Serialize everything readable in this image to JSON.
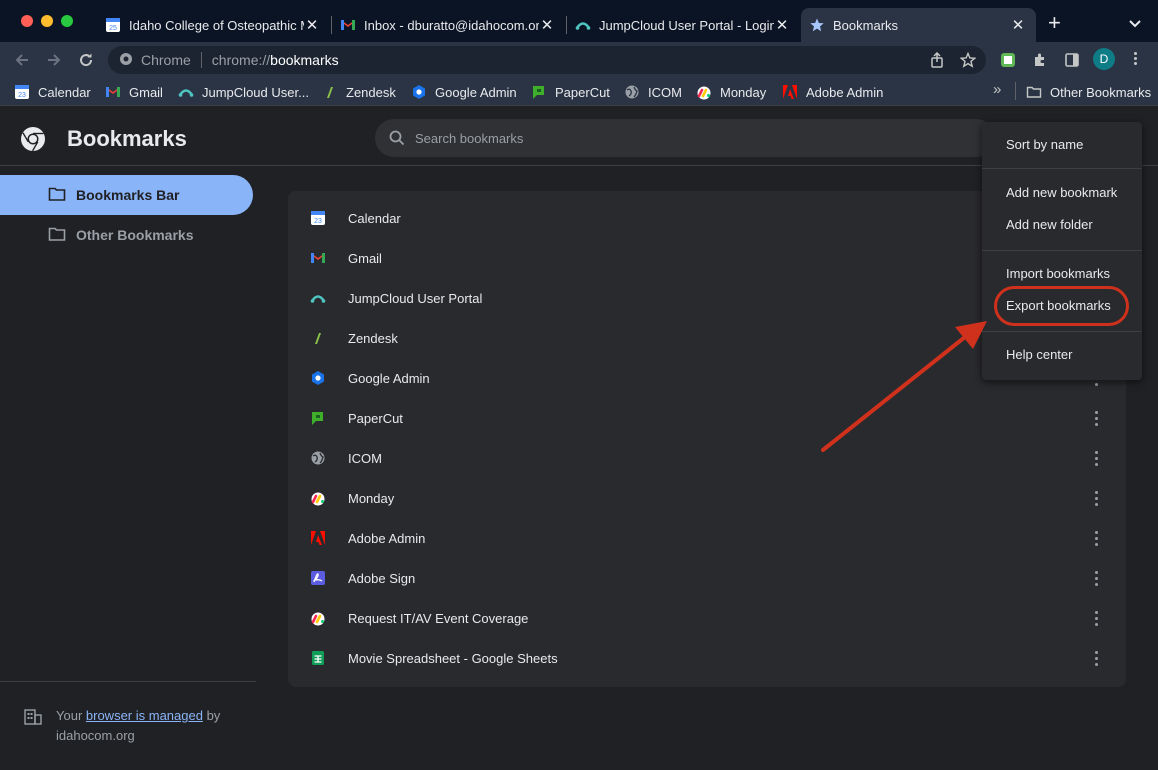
{
  "colors": {
    "accent": "#8ab4f8",
    "annotation_red": "#d0311c",
    "background": "#202124",
    "tabstrip": "#0b1424",
    "card": "#292a2d"
  },
  "tabs": [
    {
      "title": "Idaho College of Osteopathic Medicine",
      "icon": "calendar-icon",
      "active": false
    },
    {
      "title": "Inbox - dburatto@idahocom.org",
      "icon": "gmail-icon",
      "active": false
    },
    {
      "title": "JumpCloud User Portal - Login",
      "icon": "jumpcloud-icon",
      "active": false
    },
    {
      "title": "Bookmarks",
      "icon": "star-icon",
      "active": true
    }
  ],
  "omnibox": {
    "site_label": "Chrome",
    "url_scheme": "chrome://",
    "url_host": "bookmarks"
  },
  "profile_initial": "D",
  "bookmarks_bar": {
    "items": [
      {
        "label": "Calendar",
        "icon": "calendar-icon"
      },
      {
        "label": "Gmail",
        "icon": "gmail-icon"
      },
      {
        "label": "JumpCloud User...",
        "icon": "jumpcloud-icon"
      },
      {
        "label": "Zendesk",
        "icon": "zendesk-icon"
      },
      {
        "label": "Google Admin",
        "icon": "google-admin-icon"
      },
      {
        "label": "PaperCut",
        "icon": "papercut-icon"
      },
      {
        "label": "ICOM",
        "icon": "globe-icon"
      },
      {
        "label": "Monday",
        "icon": "monday-icon"
      },
      {
        "label": "Adobe Admin",
        "icon": "adobe-icon"
      }
    ],
    "overflow_label": "»",
    "other_bookmarks_label": "Other Bookmarks"
  },
  "header": {
    "title": "Bookmarks",
    "search_placeholder": "Search bookmarks"
  },
  "sidebar": {
    "folders": [
      {
        "label": "Bookmarks Bar",
        "selected": true
      },
      {
        "label": "Other Bookmarks",
        "selected": false
      }
    ],
    "managed": {
      "prefix": "Your ",
      "link": "browser is managed",
      "suffix": " by",
      "domain": "idahocom.org"
    }
  },
  "bookmarks": [
    {
      "title": "Calendar",
      "icon": "calendar-icon"
    },
    {
      "title": "Gmail",
      "icon": "gmail-icon"
    },
    {
      "title": "JumpCloud User Portal",
      "icon": "jumpcloud-icon"
    },
    {
      "title": "Zendesk",
      "icon": "zendesk-icon"
    },
    {
      "title": "Google Admin",
      "icon": "google-admin-icon"
    },
    {
      "title": "PaperCut",
      "icon": "papercut-icon"
    },
    {
      "title": "ICOM",
      "icon": "globe-icon"
    },
    {
      "title": "Monday",
      "icon": "monday-icon"
    },
    {
      "title": "Adobe Admin",
      "icon": "adobe-icon"
    },
    {
      "title": "Adobe Sign",
      "icon": "adobe-sign-icon"
    },
    {
      "title": "Request IT/AV Event Coverage",
      "icon": "monday-icon"
    },
    {
      "title": "Movie Spreadsheet - Google Sheets",
      "icon": "sheets-icon"
    }
  ],
  "menu": {
    "sort": "Sort by name",
    "add_bookmark": "Add new bookmark",
    "add_folder": "Add new folder",
    "import": "Import bookmarks",
    "export": "Export bookmarks",
    "help": "Help center"
  }
}
